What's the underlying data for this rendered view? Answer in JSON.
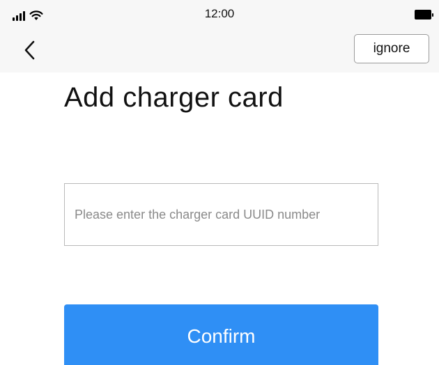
{
  "status_bar": {
    "time": "12:00",
    "icons": [
      "signal-icon",
      "wifi-icon",
      "battery-icon"
    ]
  },
  "nav": {
    "back_icon": "chevron-left-icon",
    "ignore_label": "ignore"
  },
  "page": {
    "title": "Add charger card"
  },
  "form": {
    "uuid_placeholder": "Please enter the charger card UUID number",
    "uuid_value": "",
    "confirm_label": "Confirm"
  },
  "colors": {
    "primary": "#2f8ff5",
    "header_background": "#f7f7f7",
    "input_border": "#b9b9b9"
  }
}
